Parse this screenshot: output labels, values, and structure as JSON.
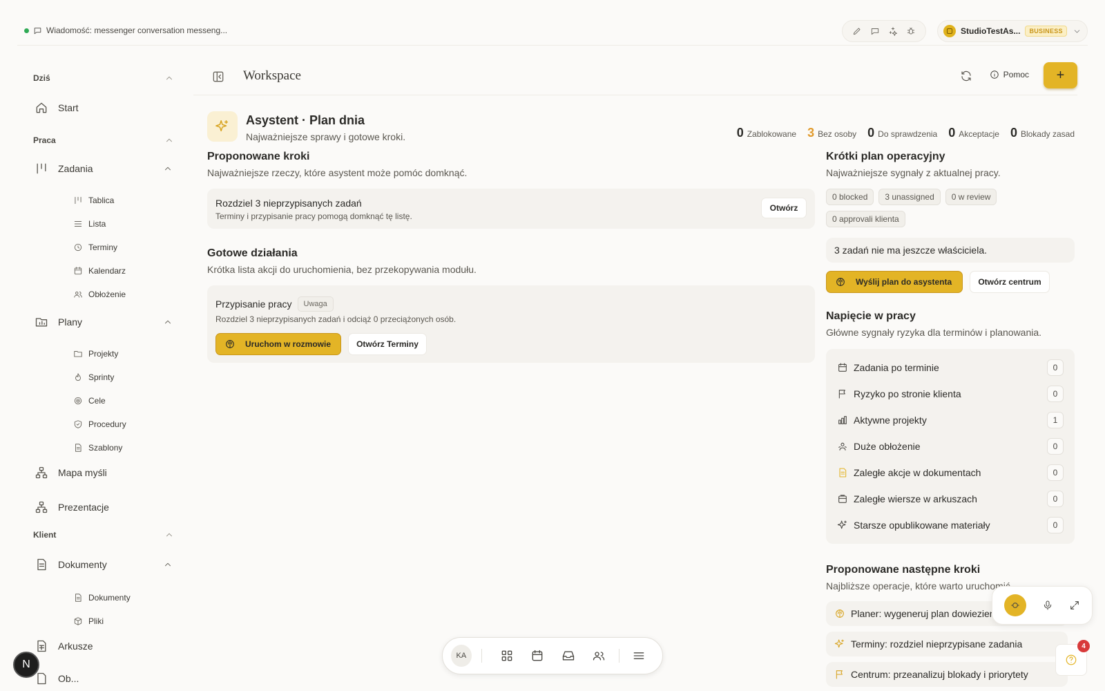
{
  "topbar": {
    "message": "Wiadomość: messenger conversation messeng...",
    "org_name": "StudioTestAs...",
    "org_plan": "BUSINESS"
  },
  "sidebar": {
    "sections": {
      "today": "Dziś",
      "work": "Praca",
      "client": "Klient"
    },
    "start": "Start",
    "tasks": "Zadania",
    "tasks_sub": [
      "Tablica",
      "Lista",
      "Terminy",
      "Kalendarz",
      "Obłożenie"
    ],
    "plans": "Plany",
    "plans_sub": [
      "Projekty",
      "Sprinty",
      "Cele",
      "Procedury",
      "Szablony"
    ],
    "mindmap": "Mapa myśli",
    "presentations": "Prezentacje",
    "documents": "Dokumenty",
    "documents_sub": [
      "Dokumenty",
      "Pliki"
    ],
    "sheets": "Arkusze",
    "cut_item": "Ob..."
  },
  "header": {
    "title": "Workspace",
    "help": "Pomoc",
    "plus": "+"
  },
  "assistant": {
    "title": "Asystent · Plan dnia",
    "subtitle": "Najważniejsze sprawy i gotowe kroki.",
    "stats": [
      {
        "n": "0",
        "label": "Zablokowane"
      },
      {
        "n": "3",
        "label": "Bez osoby"
      },
      {
        "n": "0",
        "label": "Do sprawdzenia"
      },
      {
        "n": "0",
        "label": "Akceptacje"
      },
      {
        "n": "0",
        "label": "Blokady zasad"
      }
    ]
  },
  "proposed": {
    "title": "Proponowane kroki",
    "subtitle": "Najważniejsze rzeczy, które asystent może pomóc domknąć.",
    "card_title": "Rozdziel 3 nieprzypisanych zadań",
    "card_desc": "Terminy i przypisanie pracy pomogą domknąć tę listę.",
    "card_button": "Otwórz"
  },
  "ready": {
    "title": "Gotowe działania",
    "subtitle": "Krótka lista akcji do uruchomienia, bez przekopywania modułu.",
    "card_title": "Przypisanie pracy",
    "card_tag": "Uwaga",
    "card_desc": "Rozdziel 3 nieprzypisanych zadań i odciąż 0 przeciążonych osób.",
    "btn_primary": "Uruchom w rozmowie",
    "btn_secondary": "Otwórz Terminy"
  },
  "ops": {
    "title": "Krótki plan operacyjny",
    "subtitle": "Najważniejsze sygnały z aktualnej pracy.",
    "chips": [
      "0 blocked",
      "3 unassigned",
      "0 w review",
      "0 approvali klienta"
    ],
    "note": "3 zadań nie ma jeszcze właściciela.",
    "btn_primary": "Wyślij plan do asystenta",
    "btn_secondary": "Otwórz centrum"
  },
  "tension": {
    "title": "Napięcie w pracy",
    "subtitle": "Główne sygnały ryzyka dla terminów i planowania.",
    "rows": [
      {
        "label": "Zadania po terminie",
        "count": "0",
        "icon": "calendar-icon"
      },
      {
        "label": "Ryzyko po stronie klienta",
        "count": "0",
        "icon": "flag-icon"
      },
      {
        "label": "Aktywne projekty",
        "count": "1",
        "icon": "bar-chart-icon"
      },
      {
        "label": "Duże obłożenie",
        "count": "0",
        "icon": "users-icon"
      },
      {
        "label": "Zaległe akcje w dokumentach",
        "count": "0",
        "icon": "document-icon"
      },
      {
        "label": "Zaległe wiersze w arkuszach",
        "count": "0",
        "icon": "sheet-icon"
      },
      {
        "label": "Starsze opublikowane materiały",
        "count": "0",
        "icon": "sparkles-icon"
      }
    ]
  },
  "next": {
    "title": "Proponowane następne kroki",
    "subtitle": "Najbliższe operacje, które warto uruchomić.",
    "rows": [
      "Planer: wygeneruj plan dowiezienia",
      "Terminy: rozdziel nieprzypisane zadania",
      "Centrum: przeanalizuj blokady i priorytety"
    ]
  },
  "dock": {
    "avatar": "KA"
  },
  "notifications": {
    "count": "4"
  },
  "fab": {
    "label": "N"
  },
  "colors": {
    "accent": "#e3b426",
    "warn": "#e19b2e",
    "badge": "#d83a3a"
  }
}
